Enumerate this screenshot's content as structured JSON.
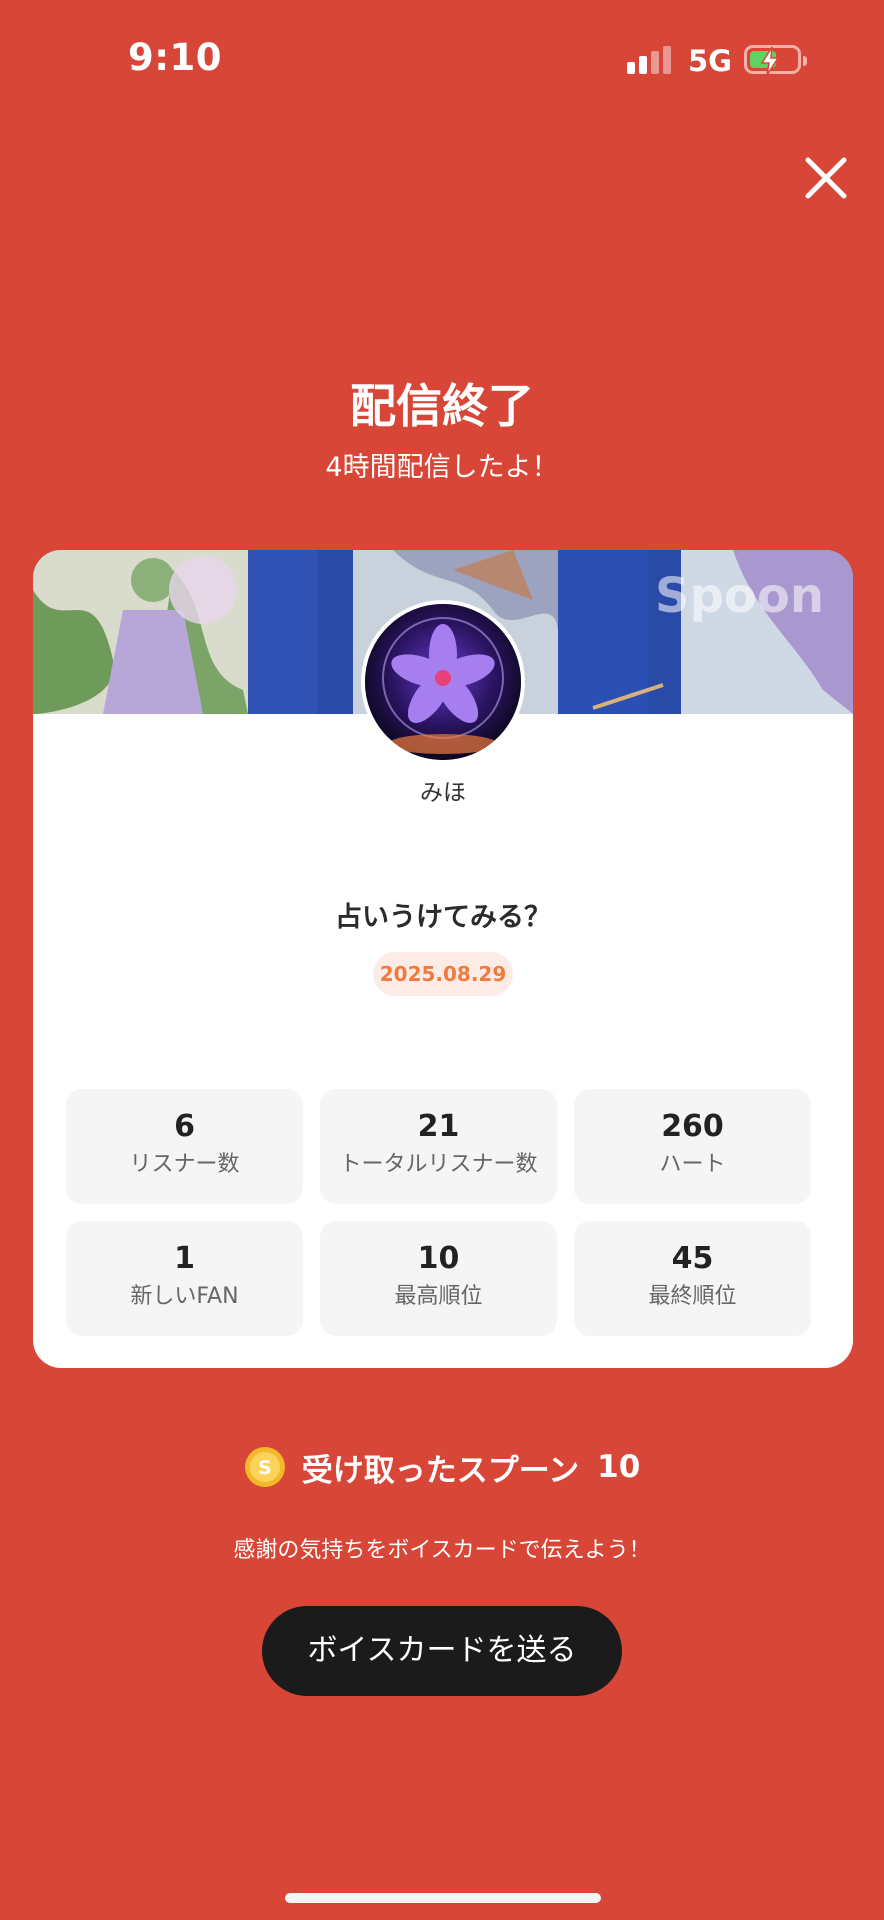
{
  "status_bar": {
    "time": "9:10",
    "network": "5G"
  },
  "header": {
    "title": "配信終了",
    "subtitle": "4時間配信したよ！"
  },
  "card": {
    "watermark": "Spoon",
    "username": "みほ",
    "broadcast_title": "占いうけてみる？",
    "date": "2025.08.29",
    "stats": [
      {
        "value": "6",
        "label": "リスナー数"
      },
      {
        "value": "21",
        "label": "トータルリスナー数"
      },
      {
        "value": "260",
        "label": "ハート"
      },
      {
        "value": "1",
        "label": "新しいFAN"
      },
      {
        "value": "10",
        "label": "最高順位"
      },
      {
        "value": "45",
        "label": "最終順位"
      }
    ]
  },
  "spoons": {
    "label": "受け取ったスプーン",
    "count": "10",
    "coin_symbol": "S"
  },
  "message": "感謝の気持ちをボイスカードで伝えよう！",
  "voice_card_button": "ボイスカードを送る",
  "colors": {
    "background": "#d84638",
    "card": "#ffffff",
    "accent_date": "#ef7b3f",
    "button": "#1c1b1b"
  }
}
